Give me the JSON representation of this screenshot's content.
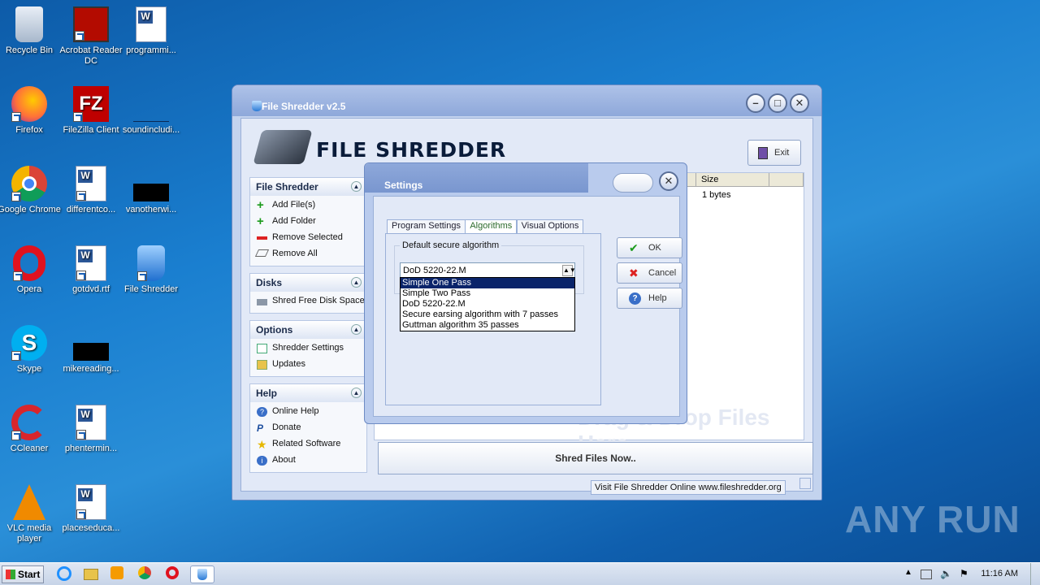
{
  "desktop": {
    "icons": [
      {
        "label": "Recycle Bin"
      },
      {
        "label": "Acrobat Reader DC"
      },
      {
        "label": "programmi..."
      },
      {
        "label": "Firefox"
      },
      {
        "label": "FileZilla Client"
      },
      {
        "label": "soundincludi..."
      },
      {
        "label": "Google Chrome"
      },
      {
        "label": "differentco..."
      },
      {
        "label": "vanotherwi..."
      },
      {
        "label": "Opera"
      },
      {
        "label": "gotdvd.rtf"
      },
      {
        "label": "File Shredder"
      },
      {
        "label": "Skype"
      },
      {
        "label": "mikereading..."
      },
      {
        "label": "CCleaner"
      },
      {
        "label": "phentermin..."
      },
      {
        "label": "VLC media player"
      },
      {
        "label": "placeseduca..."
      }
    ]
  },
  "window": {
    "title": "File Shredder v2.5",
    "logo_text": "FILE SHREDDER",
    "exit_label": "Exit",
    "sidebar": {
      "file_shredder": {
        "title": "File Shredder",
        "items": [
          "Add File(s)",
          "Add Folder",
          "Remove Selected",
          "Remove All"
        ]
      },
      "disks": {
        "title": "Disks",
        "items": [
          "Shred Free Disk Space"
        ]
      },
      "options": {
        "title": "Options",
        "items": [
          "Shredder Settings",
          "Updates"
        ]
      },
      "help": {
        "title": "Help",
        "items": [
          "Online Help",
          "Donate",
          "Related Software",
          "About"
        ]
      }
    },
    "filelist": {
      "size_header": "Size",
      "size_value": "1 bytes",
      "drag_hint": "Drag & Drop Files Here"
    },
    "shred_button": "Shred Files Now..",
    "status": "Visit File Shredder Online   www.fileshredder.org"
  },
  "settings": {
    "title": "Settings",
    "tabs": [
      "Program Settings",
      "Algorithms",
      "Visual Options"
    ],
    "active_tab": "Algorithms",
    "group_label": "Default secure algorithm",
    "selected": "DoD 5220-22.M",
    "options": [
      "Simple One Pass",
      "Simple Two Pass",
      "DoD 5220-22.M",
      "Secure earsing algorithm with 7 passes",
      "Guttman algorithm 35 passes"
    ],
    "highlighted_option": "Simple One Pass",
    "buttons": {
      "ok": "OK",
      "cancel": "Cancel",
      "help": "Help"
    }
  },
  "taskbar": {
    "start": "Start",
    "clock": "11:16 AM"
  },
  "watermark": "ANY RUN"
}
